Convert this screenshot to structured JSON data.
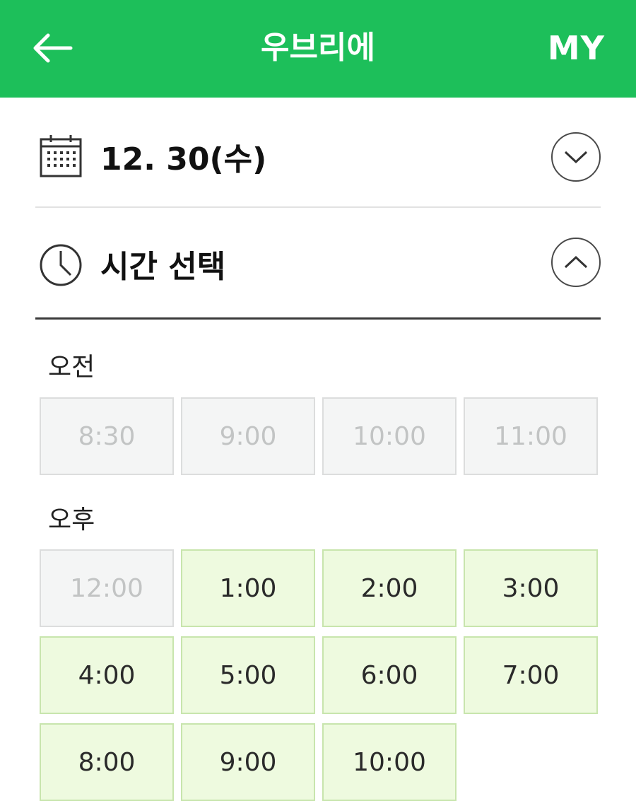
{
  "header": {
    "title": "우브리에",
    "my_label": "MY",
    "background": "#1dbf5a"
  },
  "date_row": {
    "icon": "calendar-icon",
    "date": "12. 30(수)",
    "toggle_icon": "chevron-down-icon"
  },
  "time_row": {
    "icon": "clock-icon",
    "label": "시간 선택",
    "toggle_icon": "chevron-up-icon"
  },
  "am": {
    "label": "오전",
    "slots": [
      {
        "time": "8:30",
        "available": false
      },
      {
        "time": "9:00",
        "available": false
      },
      {
        "time": "10:00",
        "available": false
      },
      {
        "time": "11:00",
        "available": false
      }
    ]
  },
  "pm": {
    "label": "오후",
    "slots": [
      {
        "time": "12:00",
        "available": false
      },
      {
        "time": "1:00",
        "available": true
      },
      {
        "time": "2:00",
        "available": true
      },
      {
        "time": "3:00",
        "available": true
      },
      {
        "time": "4:00",
        "available": true
      },
      {
        "time": "5:00",
        "available": true
      },
      {
        "time": "6:00",
        "available": true
      },
      {
        "time": "7:00",
        "available": true
      },
      {
        "time": "8:00",
        "available": true
      },
      {
        "time": "9:00",
        "available": true
      },
      {
        "time": "10:00",
        "available": true
      }
    ]
  },
  "colors": {
    "accent": "#1dbf5a",
    "available_bg": "#eefadf",
    "disabled_bg": "#f4f5f5"
  }
}
